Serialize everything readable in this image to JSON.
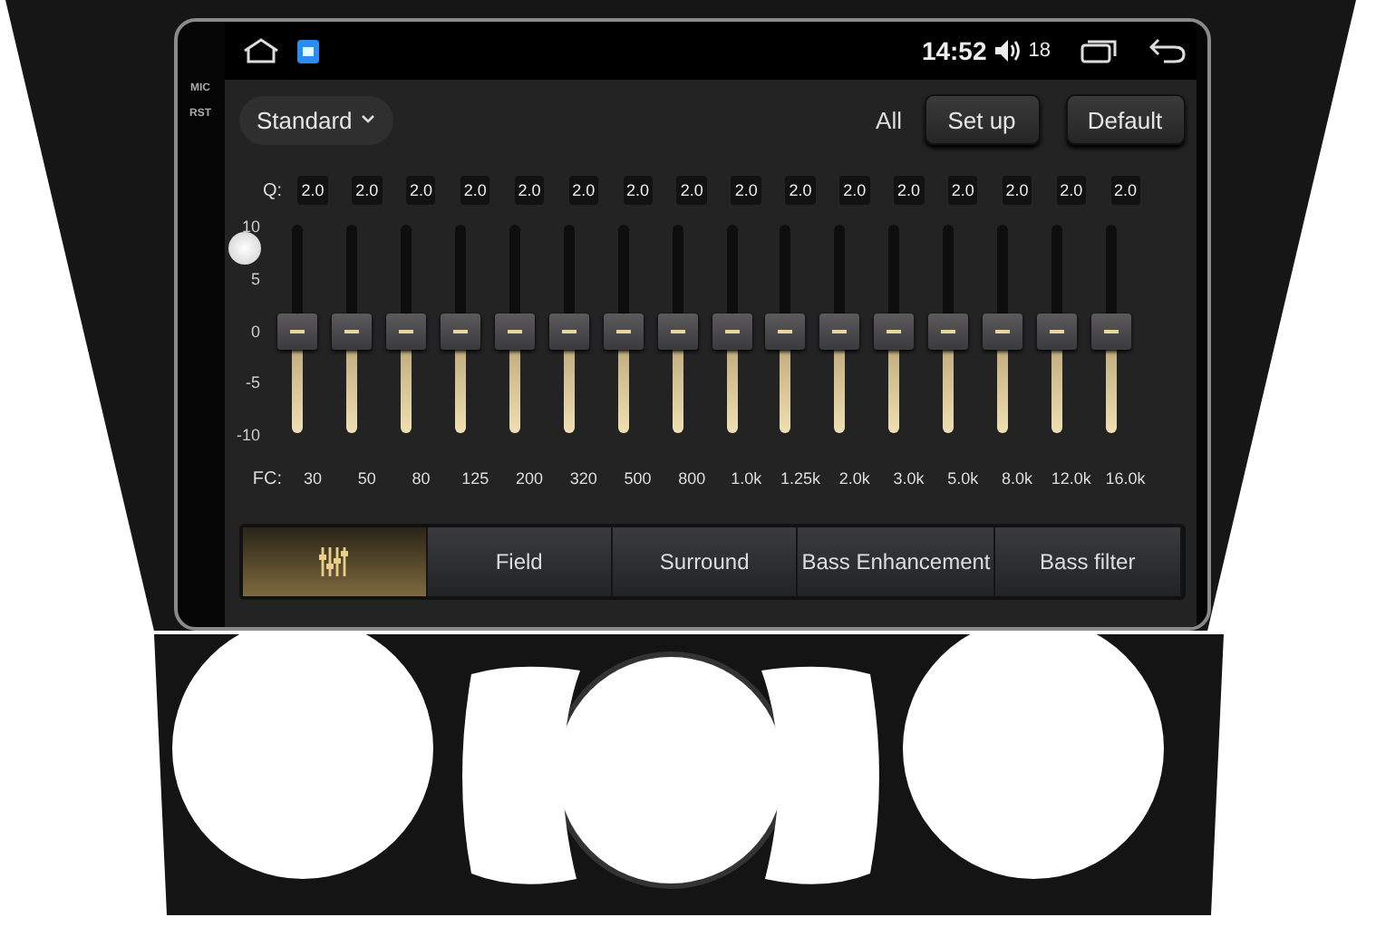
{
  "status_bar": {
    "time": "14:52",
    "volume": "18"
  },
  "bezel_labels": [
    "MIC",
    "RST"
  ],
  "toolbar": {
    "preset": "Standard",
    "mode": "All",
    "buttons": [
      "Set up",
      "Default"
    ]
  },
  "equalizer": {
    "q_label": "Q:",
    "fc_label": "FC:",
    "scale": [
      "10",
      "5",
      "0",
      "-5",
      "-10"
    ],
    "bands": [
      {
        "q": "2.0",
        "fc": "30",
        "level": 0.5
      },
      {
        "q": "2.0",
        "fc": "50",
        "level": 0.5
      },
      {
        "q": "2.0",
        "fc": "80",
        "level": 0.5
      },
      {
        "q": "2.0",
        "fc": "125",
        "level": 0.5
      },
      {
        "q": "2.0",
        "fc": "200",
        "level": 0.5
      },
      {
        "q": "2.0",
        "fc": "320",
        "level": 0.5
      },
      {
        "q": "2.0",
        "fc": "500",
        "level": 0.5
      },
      {
        "q": "2.0",
        "fc": "800",
        "level": 0.5
      },
      {
        "q": "2.0",
        "fc": "1.0k",
        "level": 0.5
      },
      {
        "q": "2.0",
        "fc": "1.25k",
        "level": 0.5
      },
      {
        "q": "2.0",
        "fc": "2.0k",
        "level": 0.5
      },
      {
        "q": "2.0",
        "fc": "3.0k",
        "level": 0.5
      },
      {
        "q": "2.0",
        "fc": "5.0k",
        "level": 0.5
      },
      {
        "q": "2.0",
        "fc": "8.0k",
        "level": 0.5
      },
      {
        "q": "2.0",
        "fc": "12.0k",
        "level": 0.5
      },
      {
        "q": "2.0",
        "fc": "16.0k",
        "level": 0.5
      }
    ]
  },
  "tabs": [
    {
      "kind": "icon",
      "selected": true
    },
    {
      "kind": "text",
      "label": "Field",
      "selected": false
    },
    {
      "kind": "text",
      "label": "Surround",
      "selected": false
    },
    {
      "kind": "text",
      "label": "Bass Enhancement",
      "selected": false
    },
    {
      "kind": "text",
      "label": "Bass filter",
      "selected": false
    }
  ]
}
